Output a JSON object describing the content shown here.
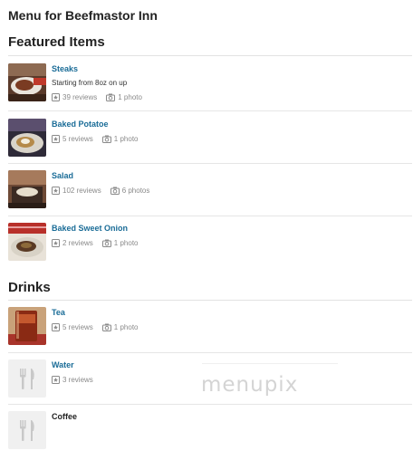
{
  "page": {
    "title": "Menu for Beefmastor Inn"
  },
  "sections": [
    {
      "title": "Featured Items",
      "items": [
        {
          "name": "Steaks",
          "description": "Starting from 8oz on up",
          "reviews": "39 reviews",
          "photos": "1 photo",
          "thumb": "steak-photo"
        },
        {
          "name": "Baked Potatoe",
          "reviews": "5 reviews",
          "photos": "1 photo",
          "thumb": "potato-photo"
        },
        {
          "name": "Salad",
          "reviews": "102 reviews",
          "photos": "6 photos",
          "thumb": "salad-photo"
        },
        {
          "name": "Baked Sweet Onion",
          "reviews": "2 reviews",
          "photos": "1 photo",
          "thumb": "onion-photo"
        }
      ]
    },
    {
      "title": "Drinks",
      "items": [
        {
          "name": "Tea",
          "reviews": "5 reviews",
          "photos": "1 photo",
          "thumb": "tea-photo"
        },
        {
          "name": "Water",
          "reviews": "3 reviews",
          "thumb": "utensils-placeholder"
        },
        {
          "name": "Coffee",
          "thumb": "utensils-placeholder"
        }
      ]
    }
  ],
  "watermark": "menupix",
  "colors": {
    "link": "#1a6c97",
    "meta": "#8a8a8a",
    "rule": "#e2e2e2"
  }
}
